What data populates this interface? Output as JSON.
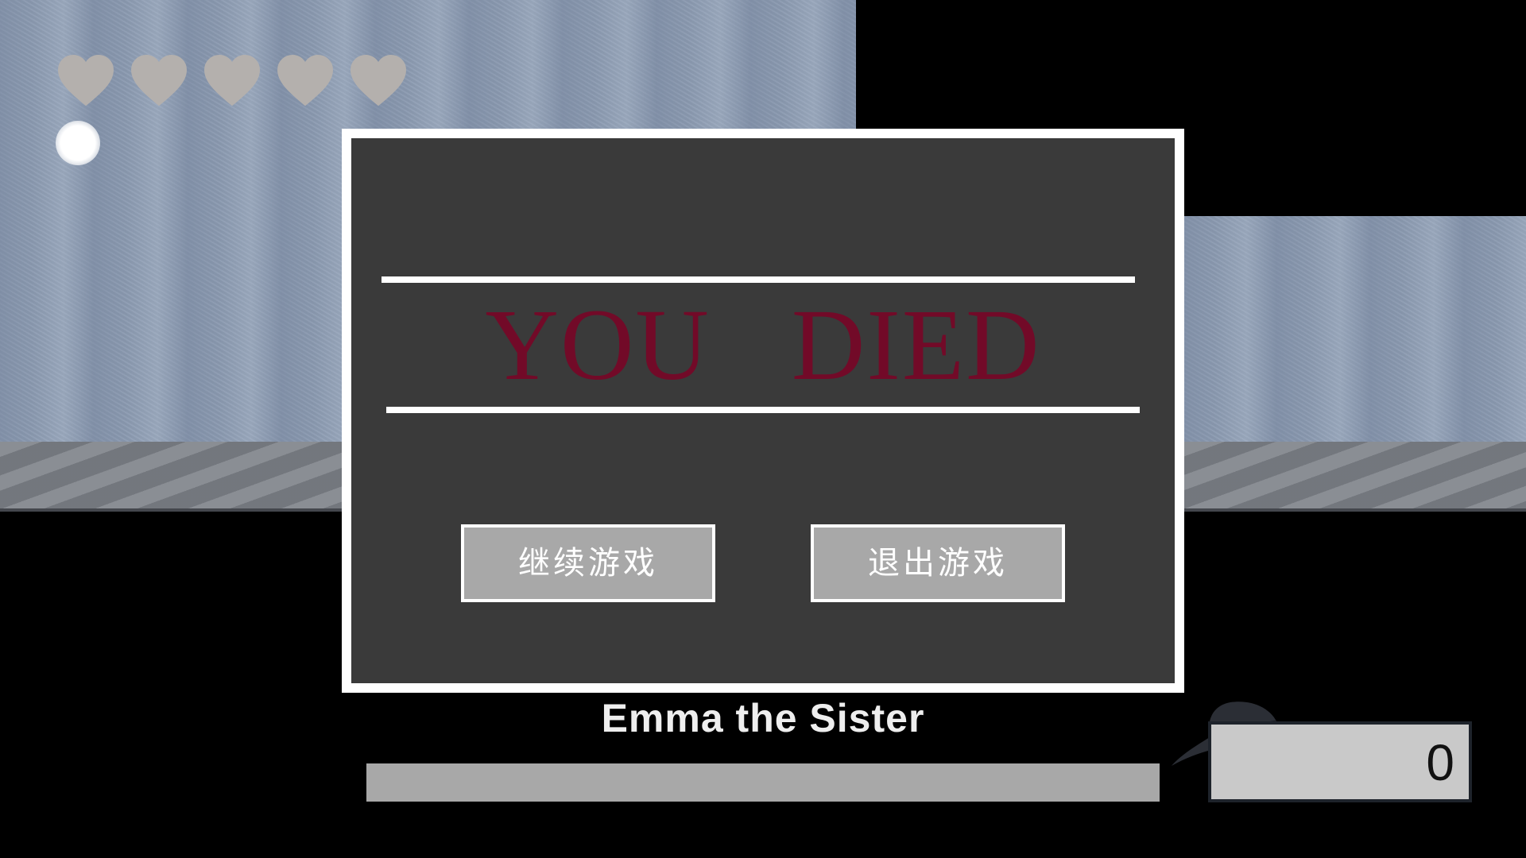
{
  "hud": {
    "health": {
      "max": 5,
      "current": 5,
      "heart_color": "#b4b0ad"
    },
    "light_orb_icon": "glowing-orb"
  },
  "death_dialog": {
    "title": "YOU   DIED",
    "title_color": "#720a28",
    "buttons": {
      "continue_label": "继续游戏",
      "quit_label": "退出游戏"
    }
  },
  "boss": {
    "name": "Emma the Sister",
    "health_fraction": 1.0
  },
  "score": {
    "icon": "cap-icon",
    "value": "0"
  }
}
